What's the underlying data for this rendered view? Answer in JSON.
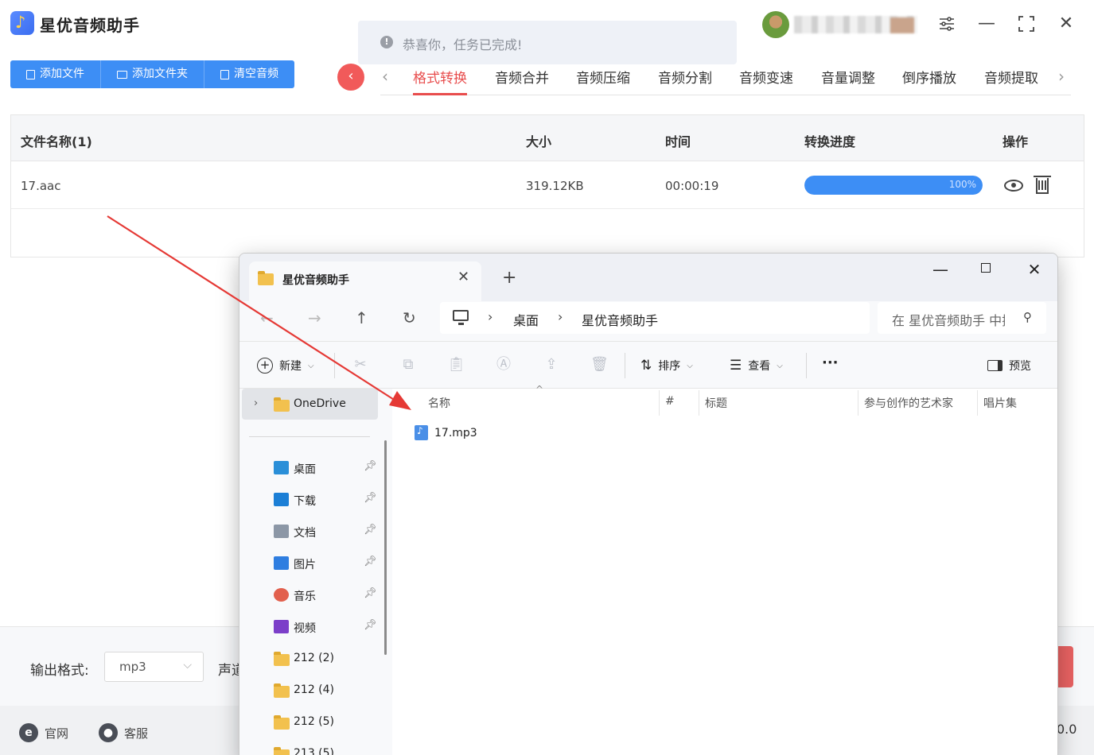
{
  "app": {
    "title": "星优音频助手",
    "toast": "恭喜你，任务已完成!"
  },
  "toolbar": {
    "add_file": "添加文件",
    "add_folder": "添加文件夹",
    "clear": "清空音频"
  },
  "tabs": [
    "格式转换",
    "音频合并",
    "音频压缩",
    "音频分割",
    "音频变速",
    "音量调整",
    "倒序播放",
    "音频提取"
  ],
  "active_tab": "格式转换",
  "table": {
    "headers": {
      "name": "文件名称(1)",
      "size": "大小",
      "time": "时间",
      "progress": "转换进度",
      "action": "操作"
    },
    "rows": [
      {
        "name": "17.aac",
        "size": "319.12KB",
        "time": "00:00:19",
        "progress_label": "100%",
        "progress": 1.0
      }
    ]
  },
  "bottom": {
    "output_label": "输出格式:",
    "output_value": "mp3",
    "channel_label": "声道"
  },
  "footer": {
    "website": "官网",
    "support": "客服",
    "version": "0.0"
  },
  "explorer": {
    "tab_title": "星优音频助手",
    "breadcrumb": [
      "桌面",
      "星优音频助手"
    ],
    "search_placeholder": "在 星优音频助手 中搜索",
    "commands": {
      "new": "新建",
      "sort": "排序",
      "view": "查看",
      "more": "···",
      "preview": "预览"
    },
    "nav": {
      "onedrive": "OneDrive",
      "items": [
        {
          "label": "桌面",
          "icon": "desktop-icon",
          "color": "#2a8fd8",
          "pinned": true
        },
        {
          "label": "下载",
          "icon": "download-icon",
          "color": "#1c7fd6",
          "pinned": true
        },
        {
          "label": "文档",
          "icon": "document-icon",
          "color": "#8c97a6",
          "pinned": true
        },
        {
          "label": "图片",
          "icon": "pictures-icon",
          "color": "#2f7ee0",
          "pinned": true
        },
        {
          "label": "音乐",
          "icon": "music-icon",
          "color": "#e2604d",
          "pinned": true
        },
        {
          "label": "视频",
          "icon": "video-icon",
          "color": "#7c3fc9",
          "pinned": true
        }
      ],
      "folders": [
        "212 (2)",
        "212 (4)",
        "212 (5)",
        "213 (5)"
      ]
    },
    "columns": [
      "名称",
      "#",
      "标题",
      "参与创作的艺术家",
      "唱片集"
    ],
    "files": [
      {
        "name": "17.mp3",
        "icon": "mp3-file-icon"
      }
    ]
  },
  "colors": {
    "accent_blue": "#3d8ef5",
    "accent_red": "#e84d4d",
    "annotation_arrow": "#e53935"
  }
}
